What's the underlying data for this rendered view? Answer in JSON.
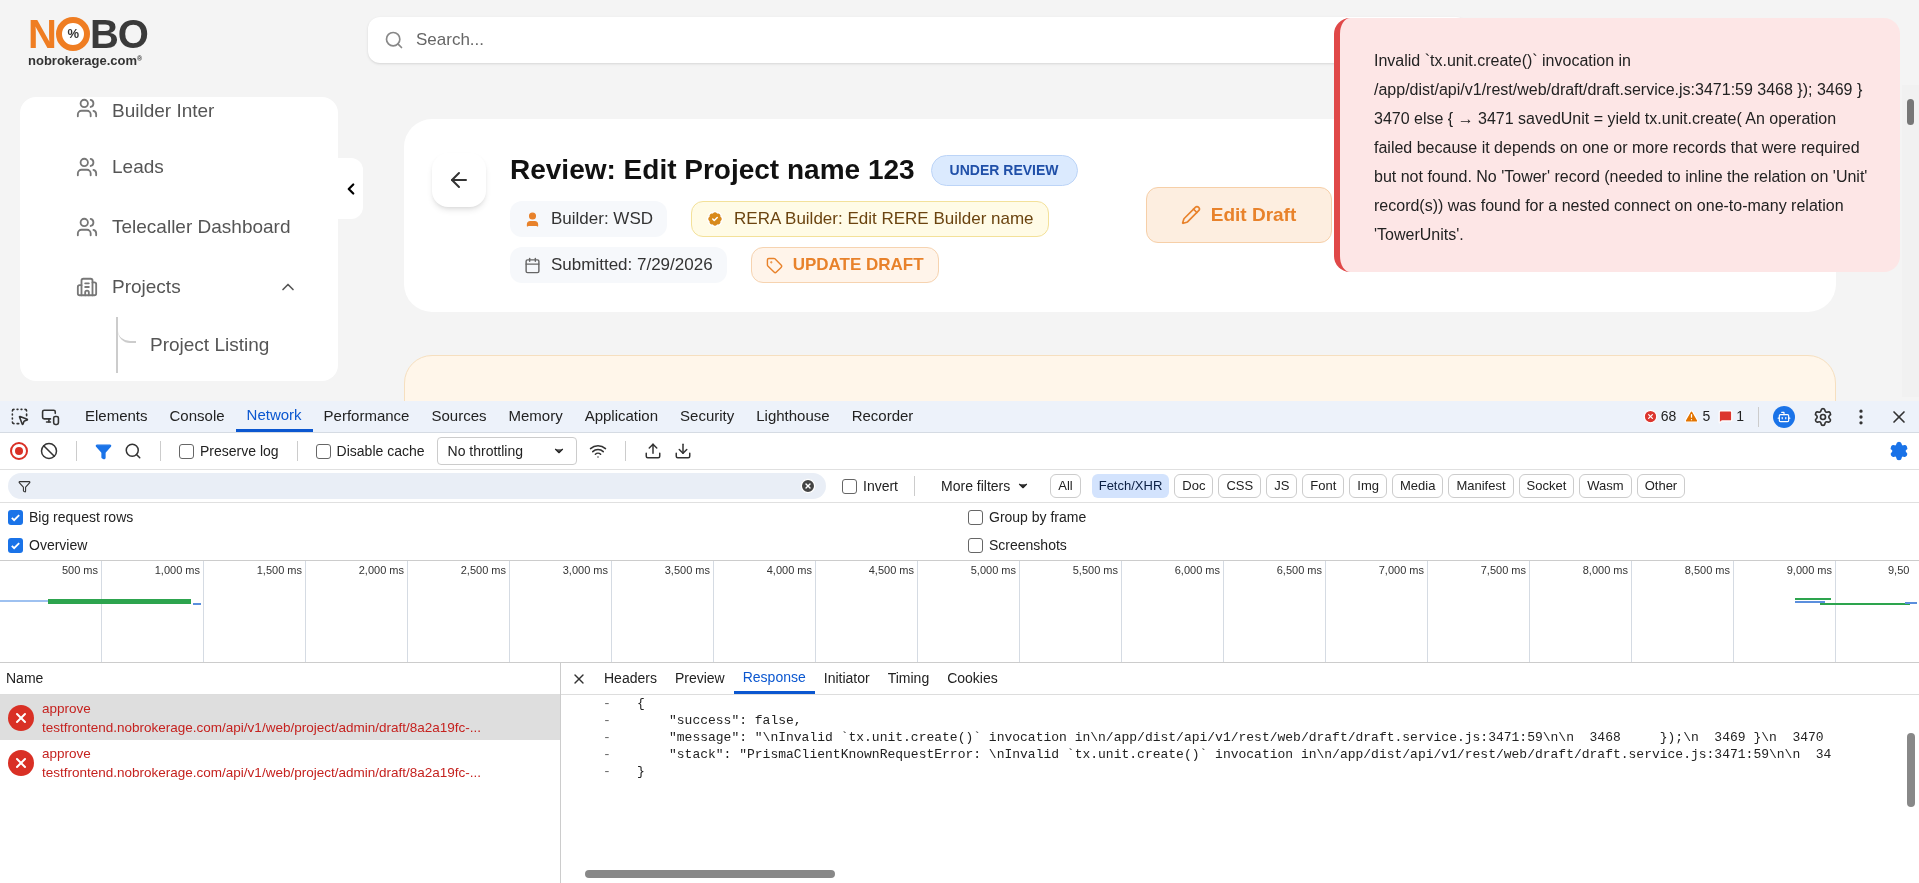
{
  "app": {
    "logo": {
      "left": "N",
      "mark": "%",
      "right": "BO",
      "domain": "nobrokerage.com",
      "registered": "®"
    },
    "search": {
      "placeholder": "Search..."
    },
    "sidebar": {
      "items": [
        {
          "kind": "link",
          "label": "Builder Inter"
        },
        {
          "kind": "link",
          "label": "Leads"
        },
        {
          "kind": "link",
          "label": "Telecaller Dashboard"
        },
        {
          "kind": "group",
          "label": "Projects",
          "expanded": true,
          "children": [
            {
              "label": "Project Listing"
            }
          ]
        }
      ]
    },
    "review": {
      "title": "Review: Edit Project name 123",
      "status": "UNDER REVIEW",
      "chips": [
        [
          {
            "kind": "builder",
            "label": "Builder: WSD"
          },
          {
            "kind": "rera",
            "label": "RERA Builder: Edit RERE Builder name"
          }
        ],
        [
          {
            "kind": "date",
            "label": "Submitted: 7/29/2026"
          },
          {
            "kind": "type",
            "label": "UPDATE DRAFT"
          }
        ]
      ],
      "edit_button": "Edit Draft"
    },
    "toast": {
      "message": "Invalid `tx.unit.create()` invocation in /app/dist/api/v1/rest/web/draft/draft.service.js:3471:59 3468 }); 3469 } 3470 else { → 3471 savedUnit = yield tx.unit.create( An operation failed because it depends on one or more records that were required but not found. No 'Tower' record (needed to inline the relation on 'Unit' record(s)) was found for a nested connect on one-to-many relation 'TowerUnits'."
    }
  },
  "devtools": {
    "tabs": [
      {
        "label": "Elements",
        "selected": false
      },
      {
        "label": "Console",
        "selected": false
      },
      {
        "label": "Network",
        "selected": true
      },
      {
        "label": "Performance",
        "selected": false
      },
      {
        "label": "Sources",
        "selected": false
      },
      {
        "label": "Memory",
        "selected": false
      },
      {
        "label": "Application",
        "selected": false
      },
      {
        "label": "Security",
        "selected": false
      },
      {
        "label": "Lighthouse",
        "selected": false
      },
      {
        "label": "Recorder",
        "selected": false
      }
    ],
    "counts": {
      "errors": "68",
      "warnings": "5",
      "issues": "1"
    },
    "toolbar": {
      "preserve_log": {
        "label": "Preserve log",
        "checked": false
      },
      "disable_cache": {
        "label": "Disable cache",
        "checked": false
      },
      "throttling": "No throttling"
    },
    "filter": {
      "invert": {
        "label": "Invert",
        "checked": false
      },
      "more_filters": "More filters",
      "types": [
        {
          "label": "All",
          "selected": false
        },
        {
          "label": "Fetch/XHR",
          "selected": true
        },
        {
          "label": "Doc",
          "selected": false
        },
        {
          "label": "CSS",
          "selected": false
        },
        {
          "label": "JS",
          "selected": false
        },
        {
          "label": "Font",
          "selected": false
        },
        {
          "label": "Img",
          "selected": false
        },
        {
          "label": "Media",
          "selected": false
        },
        {
          "label": "Manifest",
          "selected": false
        },
        {
          "label": "Socket",
          "selected": false
        },
        {
          "label": "Wasm",
          "selected": false
        },
        {
          "label": "Other",
          "selected": false
        }
      ]
    },
    "options": {
      "left": [
        {
          "label": "Big request rows",
          "checked": true
        },
        {
          "label": "Overview",
          "checked": true
        }
      ],
      "right": [
        {
          "label": "Group by frame",
          "checked": false
        },
        {
          "label": "Screenshots",
          "checked": false
        }
      ]
    },
    "timeline": {
      "ticks": [
        "500 ms",
        "1,000 ms",
        "1,500 ms",
        "2,000 ms",
        "2,500 ms",
        "3,000 ms",
        "3,500 ms",
        "4,000 ms",
        "4,500 ms",
        "5,000 ms",
        "5,500 ms",
        "6,000 ms",
        "6,500 ms",
        "7,000 ms",
        "7,500 ms",
        "8,000 ms",
        "8,500 ms",
        "9,000 ms",
        "9,50"
      ]
    },
    "requests": {
      "header": "Name",
      "rows": [
        {
          "name": "approve",
          "url": "testfrontend.nobrokerage.com/api/v1/web/project/admin/draft/8a2a19fc-...",
          "selected": true
        },
        {
          "name": "approve",
          "url": "testfrontend.nobrokerage.com/api/v1/web/project/admin/draft/8a2a19fc-...",
          "selected": false
        }
      ]
    },
    "detail": {
      "tabs": [
        {
          "label": "Headers",
          "selected": false
        },
        {
          "label": "Preview",
          "selected": false
        },
        {
          "label": "Response",
          "selected": true
        },
        {
          "label": "Initiator",
          "selected": false
        },
        {
          "label": "Timing",
          "selected": false
        },
        {
          "label": "Cookies",
          "selected": false
        }
      ],
      "lines": [
        {
          "kind": "brace",
          "gutter": "-",
          "text": "{"
        },
        {
          "kind": "member",
          "gutter": "-",
          "text": "\"success\": false,"
        },
        {
          "kind": "member",
          "gutter": "-",
          "text": "\"message\": \"\\nInvalid `tx.unit.create()` invocation in\\n/app/dist/api/v1/rest/web/draft/draft.service.js:3471:59\\n\\n  3468     });\\n  3469 }\\n  3470"
        },
        {
          "kind": "member",
          "gutter": "-",
          "text": "\"stack\": \"PrismaClientKnownRequestError: \\nInvalid `tx.unit.create()` invocation in\\n/app/dist/api/v1/rest/web/draft/draft.service.js:3471:59\\n\\n  34"
        },
        {
          "kind": "brace",
          "gutter": "-",
          "text": "}"
        }
      ]
    }
  }
}
